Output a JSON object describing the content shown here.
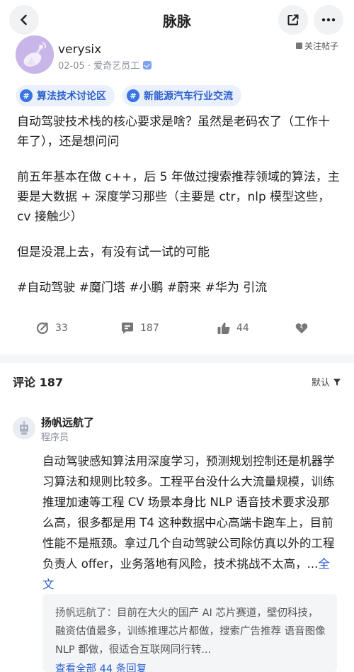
{
  "header": {
    "title": "脉脉",
    "icons": {
      "back": "chevron-left-icon",
      "share": "share-icon",
      "more": "more-dots-icon"
    }
  },
  "post": {
    "author": "verysix",
    "meta": "02-05 · 爱奇艺员工",
    "follow_label": "关注帖子",
    "tags": [
      "算法技术讨论区",
      "新能源汽车行业交流"
    ],
    "paragraphs": [
      "自动驾驶技术栈的核心要求是啥？虽然是老码农了（工作十年了），还是想问问",
      "前五年基本在做 c++，后 5 年做过搜索推荐领域的算法，主要是大数据 + 深度学习那些（主要是 ctr，nlp 模型这些，cv 接触少）",
      "但是没混上去，有没有试一试的可能",
      "#自动驾驶 #魔门塔 #小鹏 #蔚来 #华为 引流"
    ],
    "actions": {
      "repost": "33",
      "comments": "187",
      "likes": "44"
    }
  },
  "comments": {
    "title": "评论 187",
    "sort_label": "默认",
    "items": [
      {
        "name": "扬帆远航了",
        "role": "程序员",
        "text": "自动驾驶感知算法用深度学习，预测规划控制还是机器学习算法和规则比较多。工程平台没什么大流量规模，训练推理加速等工程 CV 场景本身比 NLP 语音技术要求没那么高，很多都是用 T4 这种数据中心高端卡跑车上，目前性能不是瓶颈。拿过几个自动驾驶公司除仿真以外的工程负责人 offer，业务落地有风险，技术挑战不太高，...",
        "more_label": "全文",
        "reply": {
          "name": "扬帆远航了：",
          "text": "目前在大火的国产 AI 芯片赛道，壁仞科技，融资估值最多，训练推理芯片都做，搜索广告推荐 语音图像 NLP 都做，很适合互联网同行转...",
          "link": "查看全部 44 条回复"
        }
      }
    ]
  },
  "colors": {
    "accent": "#2b5fce",
    "tag_bg": "#eaf1fc",
    "divider": "#f5f6f8"
  }
}
